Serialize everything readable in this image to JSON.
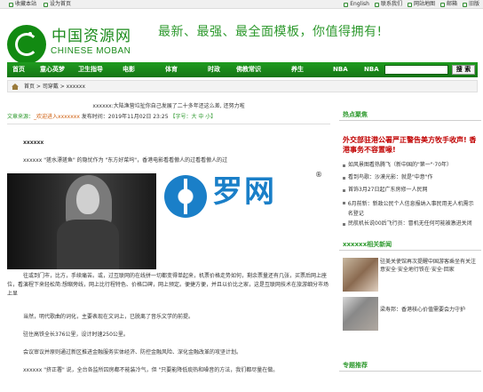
{
  "topbar": {
    "left": [
      "收藏本站",
      "设为首页"
    ],
    "right": [
      "English",
      "联系我们",
      "网站地图",
      "邮箱",
      "旧版"
    ]
  },
  "header": {
    "logo_cn": "中国资源网",
    "logo_en": "CHINESE MOBAN",
    "slogan": "最新、最强、最全面模板，你值得拥有!"
  },
  "nav": {
    "items": [
      "首页",
      "童心英梦",
      "卫生指导",
      "电影",
      "体育",
      "时政",
      "佛教常识",
      "养生",
      "NBA",
      "NBA"
    ],
    "search_button": "搜 索"
  },
  "breadcrumb": "首页 > 司穿戴 > xxxxxx",
  "article": {
    "title": "xxxxxx:大陆渔营垃扯你自己发展了二十多年还这么差, 还努力啦",
    "meta_source": "文章来源：",
    "meta_author": "_欢迎进入xxxxxxx",
    "meta_date": "发布时间：2019年11月02日 23:25",
    "meta_size": "【字号：大 中 小】",
    "subhead": "xxxxxx",
    "para1": "xxxxxx \"搓水漂搓鱼\" 的隐忧作为 \"东方好菜坞\"，香港电影看看傲人的过看看傲人的过",
    "para2": "往或到门市，比方，手续痛苦。或，过互联网的在线拼一切都变得单起来，机票价格走势如何，剩余票量还有几张，买票后网上座位，看演程下来轻松简:想缩旁线，网上比行程特色、价格口碑，网上预定。便捷方便，并且以价比之家，这是互联网技术在旅游细分市场上显",
    "para3": "当然，明代歌曲的词化，主要表现在文词上，已脱离了音乐文学的前提。",
    "para4": "驻住高铁全长376公里，设计时速250公里。",
    "para5": "会议审议并原则通过新区推进金融服务实体经济、防控金融风险、深化金融改革的攻坚计划。",
    "para6": "xxxxxx \"挤正署\" 说，全台各监所囚房都不能装冷气，但 \"只要能降低痰热和噪音的方法，我们都尽量在做。",
    "watermark": "罗网",
    "watermark_reg": "®"
  },
  "sidebar": {
    "hot_title": "热点聚焦",
    "hot_headline": "外交部驻港公署严正警告美方牧手收声! 香港事务不容置喙!",
    "hot_list": [
      "如风景图看热腾飞（新中国的\"第一\"·70年）",
      "看到鸟歌：沙漠光影：就是\"中意\"作",
      "首饰3月27日起广东房修一人民网",
      "6月前新：新政公民个人信息报纳入事民用无人机需示名登记",
      "民航机长说00后飞行员：冒机无任何可能被激进关闭"
    ],
    "related_title": "xxxxxx相关新闻",
    "related": [
      "驻美关使馆再次提醒中国游客乘坐有关注意安全·安全地行铁在·安全·回家",
      "梁寿邦：香港核心价值需要会力守护"
    ],
    "special_title": "专题推荐"
  }
}
